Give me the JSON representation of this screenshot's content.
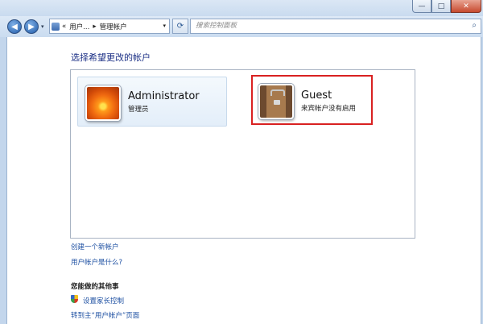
{
  "window": {
    "minimize": "—",
    "maximize": "□",
    "close": "✕"
  },
  "nav": {
    "back": "◀",
    "forward": "▶",
    "history_dropdown": "▾",
    "address": {
      "prefix": "«",
      "seg1": "用户...",
      "sep": "▸",
      "seg2": "管理帐户",
      "dropdown": "▾"
    },
    "refresh": "⟳",
    "search_placeholder": "搜索控制面板",
    "search_icon_glyph": "⌕"
  },
  "content": {
    "heading": "选择希望更改的帐户",
    "accounts": [
      {
        "name": "Administrator",
        "subtitle": "管理员",
        "selected": false
      },
      {
        "name": "Guest",
        "subtitle": "来宾帐户没有启用",
        "selected": true
      }
    ],
    "links": {
      "create_account": "创建一个新帐户",
      "what_is_account": "用户帐户是什么?"
    },
    "other_section": {
      "title": "您能做的其他事",
      "parental_control": "设置家长控制",
      "goto_main": "转到主“用户帐户”页面"
    }
  },
  "colors": {
    "link": "#1e50a2",
    "heading": "#1e3287",
    "highlight_border": "#d92121"
  }
}
